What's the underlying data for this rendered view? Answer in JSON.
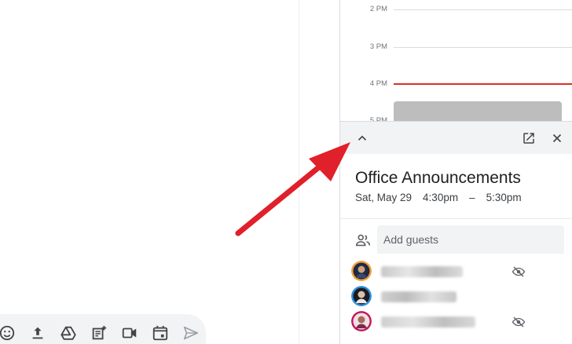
{
  "calendar": {
    "time_slots": [
      "2 PM",
      "3 PM",
      "4 PM",
      "5 PM"
    ]
  },
  "event": {
    "title": "Office Announcements",
    "date": "Sat, May 29",
    "start": "4:30pm",
    "dash": "–",
    "end": "5:30pm"
  },
  "guests": {
    "placeholder": "Add guests"
  },
  "colors": {
    "now_line": "#d93025",
    "annotation_arrow": "#e0202a",
    "event_block": "#bdbdbd"
  },
  "icons": {
    "collapse": "chevron-up-icon",
    "open_new": "open-in-new-icon",
    "close": "close-icon",
    "people": "people-icon",
    "eye_off": "eye-off-icon"
  }
}
